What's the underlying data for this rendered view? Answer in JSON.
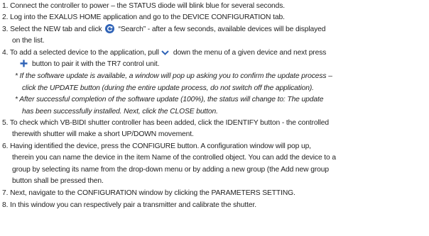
{
  "lines": [
    "1. Connect the controller to power – the STATUS diode will blink blue for several seconds.",
    "2. Log into the EXALUS HOME application and go to the DEVICE CONFIGURATION tab.",
    {
      "before": "3. Select the NEW tab and click",
      "after": "“Search” - after a few seconds, available devices will be displayed"
    },
    "on the list.",
    {
      "before": "4. To add a selected device to the application, pull",
      "after": "down the menu of a given device and next press"
    },
    "button to pair it with the TR7 control unit.",
    "* If the software update is available, a window will pop up asking you to confirm the update process –",
    "click the UPDATE button (during the entire update process, do not switch off the application).",
    "* After successful completion of the software update (100%), the status will change to: The update",
    "has been successfully installed. Next, click the CLOSE button.",
    "5. To check which VB-BIDI shutter controller has been added, click the IDENTIFY button - the controlled",
    "therewith shutter will make a short UP/DOWN movement.",
    "6. Having identified the device, press the CONFIGURE button. A configuration window will pop up,",
    "therein you can name the device in the item Name of the controlled object. You can add the device to a",
    "group by selecting its name from the drop-down menu or by adding a new group (the Add new group",
    "button shall be pressed then.",
    "7. Next, navigate to the CONFIGURATION window by clicking the PARAMETERS SETTING.",
    "8. In this window you can respectively pair a transmitter and calibrate the shutter."
  ],
  "icons": {
    "search": "refresh-search-icon",
    "chevron": "chevron-down-icon",
    "plus": "plus-icon",
    "accent": "#2f63b7"
  }
}
